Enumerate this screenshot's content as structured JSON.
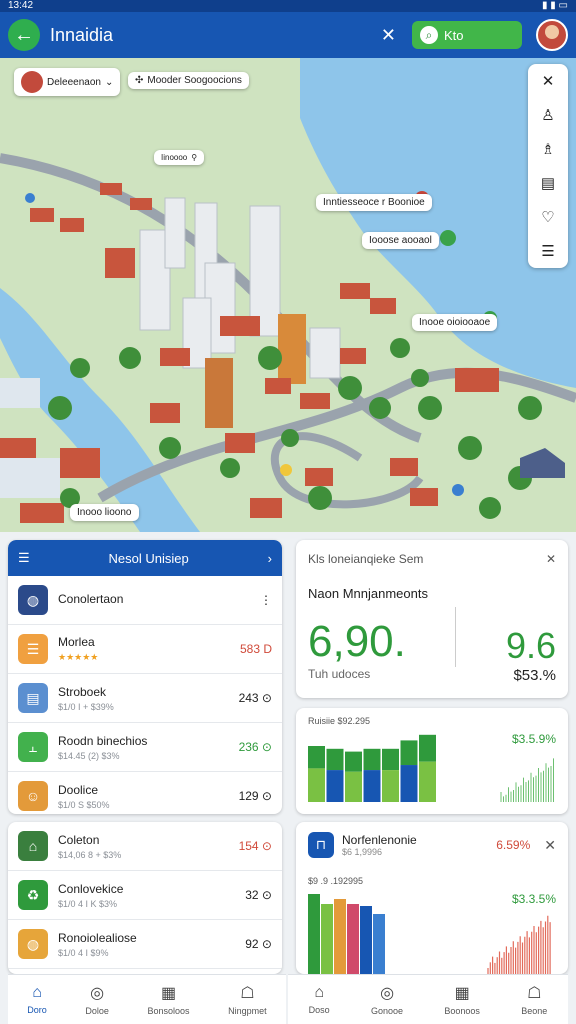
{
  "status_bar": {
    "time": "13:42"
  },
  "app_bar": {
    "title": "Innaidia",
    "search_label": "Kto"
  },
  "map": {
    "chip_top_left": "Deleeenaon",
    "chip_search": "Mooder Soogoocions",
    "callouts": [
      "Inntiesseoce r Boonioe",
      "Iooose aooaol",
      "Inooe oioiooaoe",
      "Inooo lioono",
      "Iinoooo"
    ]
  },
  "left_panel": {
    "title": "Nesol Unisiep",
    "items": [
      {
        "name": "Conolertaon",
        "sub": "",
        "value": "⋮",
        "icon": "globe-icon",
        "color": "#2b4a8a"
      },
      {
        "name": "Morlea",
        "sub": "★★★★★",
        "value": "583 D",
        "icon": "list-icon",
        "color": "#f0a040",
        "valcolor": "#d04a3a"
      },
      {
        "name": "Stroboek",
        "sub": "$1/0  I  + $39%",
        "value": "243 ⊙",
        "icon": "document-icon",
        "color": "#5b8fd0"
      },
      {
        "name": "Roodn binechios",
        "sub": "$14.45  (2)  $3%",
        "value": "236 ⊙",
        "icon": "chart-icon",
        "color": "#42b14d",
        "valcolor": "#2f9a3c"
      },
      {
        "name": "Doolice",
        "sub": "$1/0  S  $50%",
        "value": "129 ⊙",
        "icon": "person-icon",
        "color": "#e39a3a"
      }
    ],
    "items2": [
      {
        "name": "Coleton",
        "sub": "$14,06 8  + $3%",
        "value": "154 ⊙",
        "icon": "building-icon",
        "color": "#3a7f3e",
        "valcolor": "#d04a3a"
      },
      {
        "name": "Conlovekice",
        "sub": "$1/0 4 I  K  $3%",
        "value": "32 ⊙",
        "icon": "recycle-icon",
        "color": "#2f9a3c"
      },
      {
        "name": "Ronoiolealiose",
        "sub": "$1/0 4  I  $9%",
        "value": "92 ⊙",
        "icon": "globe-icon",
        "color": "#e6a53a"
      }
    ]
  },
  "summary_card": {
    "title": "Kls loneianqieke Sem",
    "subtitle": "Naon Mnnjanmeonts",
    "big_left": "6,90.",
    "big_right": "9.6",
    "foot_left": "Tuh udoces",
    "foot_right": "$53.%"
  },
  "bar_card": {
    "label": "Ruisiie $92.295",
    "pct": "$3.5.9%"
  },
  "perf_card": {
    "title": "Norfenlenonie",
    "subtitle": "$6 1,9996",
    "pct": "6.59%",
    "label": "$9 .9 .192995",
    "pct2": "$3.3.5%"
  },
  "nav_left": [
    "Doro",
    "Doloe",
    "Bonsoloos",
    "Ningpmet"
  ],
  "nav_right": [
    "Doso",
    "Gonooe",
    "Boonoos",
    "Beone"
  ],
  "chart_data": [
    {
      "type": "bar",
      "series": [
        {
          "name": "",
          "values": [
            40,
            38,
            36,
            38,
            38,
            44,
            48
          ]
        }
      ],
      "colors": [
        "#2f9a3c",
        "#1756b2",
        "#7ac143"
      ]
    },
    {
      "type": "bar",
      "series": [
        {
          "name": "",
          "values": [
            80,
            70,
            75,
            70,
            68,
            60
          ]
        }
      ]
    }
  ]
}
